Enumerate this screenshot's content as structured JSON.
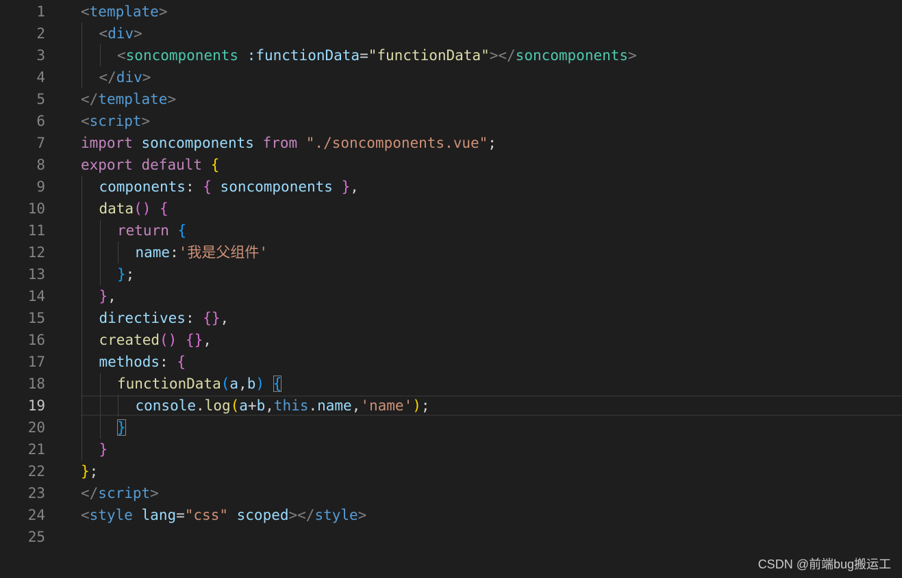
{
  "editor": {
    "active_line": 19,
    "lines": [
      {
        "n": "1",
        "indent": 0,
        "tokens": [
          {
            "t": "<",
            "c": "#808080"
          },
          {
            "t": "template",
            "c": "#569cd6"
          },
          {
            "t": ">",
            "c": "#808080"
          }
        ]
      },
      {
        "n": "2",
        "indent": 1,
        "tokens": [
          {
            "t": "<",
            "c": "#808080"
          },
          {
            "t": "div",
            "c": "#569cd6"
          },
          {
            "t": ">",
            "c": "#808080"
          }
        ]
      },
      {
        "n": "3",
        "indent": 2,
        "tokens": [
          {
            "t": "<",
            "c": "#808080"
          },
          {
            "t": "soncomponents",
            "c": "#4ec9b0"
          },
          {
            "t": " ",
            "c": "#d4d4d4"
          },
          {
            "t": ":functionData",
            "c": "#9cdcfe"
          },
          {
            "t": "=",
            "c": "#d4d4d4"
          },
          {
            "t": "\"functionData\"",
            "c": "#dcdcaa"
          },
          {
            "t": "></",
            "c": "#808080"
          },
          {
            "t": "soncomponents",
            "c": "#4ec9b0"
          },
          {
            "t": ">",
            "c": "#808080"
          }
        ]
      },
      {
        "n": "4",
        "indent": 1,
        "tokens": [
          {
            "t": "</",
            "c": "#808080"
          },
          {
            "t": "div",
            "c": "#569cd6"
          },
          {
            "t": ">",
            "c": "#808080"
          }
        ]
      },
      {
        "n": "5",
        "indent": 0,
        "tokens": [
          {
            "t": "</",
            "c": "#808080"
          },
          {
            "t": "template",
            "c": "#569cd6"
          },
          {
            "t": ">",
            "c": "#808080"
          }
        ]
      },
      {
        "n": "6",
        "indent": 0,
        "tokens": [
          {
            "t": "<",
            "c": "#808080"
          },
          {
            "t": "script",
            "c": "#569cd6"
          },
          {
            "t": ">",
            "c": "#808080"
          }
        ]
      },
      {
        "n": "7",
        "indent": 0,
        "tokens": [
          {
            "t": "import",
            "c": "#c586c0"
          },
          {
            "t": " ",
            "c": "#d4d4d4"
          },
          {
            "t": "soncomponents",
            "c": "#9cdcfe"
          },
          {
            "t": " ",
            "c": "#d4d4d4"
          },
          {
            "t": "from",
            "c": "#c586c0"
          },
          {
            "t": " ",
            "c": "#d4d4d4"
          },
          {
            "t": "\"./soncomponents.vue\"",
            "c": "#ce9178"
          },
          {
            "t": ";",
            "c": "#d4d4d4"
          }
        ]
      },
      {
        "n": "8",
        "indent": 0,
        "tokens": [
          {
            "t": "export",
            "c": "#c586c0"
          },
          {
            "t": " ",
            "c": "#d4d4d4"
          },
          {
            "t": "default",
            "c": "#c586c0"
          },
          {
            "t": " ",
            "c": "#d4d4d4"
          },
          {
            "t": "{",
            "c": "#ffd700"
          }
        ]
      },
      {
        "n": "9",
        "indent": 1,
        "tokens": [
          {
            "t": "components",
            "c": "#9cdcfe"
          },
          {
            "t": ": ",
            "c": "#d4d4d4"
          },
          {
            "t": "{",
            "c": "#da70d6"
          },
          {
            "t": " ",
            "c": "#d4d4d4"
          },
          {
            "t": "soncomponents",
            "c": "#9cdcfe"
          },
          {
            "t": " ",
            "c": "#d4d4d4"
          },
          {
            "t": "}",
            "c": "#da70d6"
          },
          {
            "t": ",",
            "c": "#d4d4d4"
          }
        ]
      },
      {
        "n": "10",
        "indent": 1,
        "tokens": [
          {
            "t": "data",
            "c": "#dcdcaa"
          },
          {
            "t": "()",
            "c": "#da70d6"
          },
          {
            "t": " ",
            "c": "#d4d4d4"
          },
          {
            "t": "{",
            "c": "#da70d6"
          }
        ]
      },
      {
        "n": "11",
        "indent": 2,
        "tokens": [
          {
            "t": "return",
            "c": "#c586c0"
          },
          {
            "t": " ",
            "c": "#d4d4d4"
          },
          {
            "t": "{",
            "c": "#179fff"
          }
        ]
      },
      {
        "n": "12",
        "indent": 3,
        "tokens": [
          {
            "t": "name",
            "c": "#9cdcfe"
          },
          {
            "t": ":",
            "c": "#d4d4d4"
          },
          {
            "t": "'我是父组件'",
            "c": "#ce9178"
          }
        ]
      },
      {
        "n": "13",
        "indent": 2,
        "tokens": [
          {
            "t": "}",
            "c": "#179fff"
          },
          {
            "t": ";",
            "c": "#d4d4d4"
          }
        ]
      },
      {
        "n": "14",
        "indent": 1,
        "tokens": [
          {
            "t": "}",
            "c": "#da70d6"
          },
          {
            "t": ",",
            "c": "#d4d4d4"
          }
        ]
      },
      {
        "n": "15",
        "indent": 1,
        "tokens": [
          {
            "t": "directives",
            "c": "#9cdcfe"
          },
          {
            "t": ": ",
            "c": "#d4d4d4"
          },
          {
            "t": "{}",
            "c": "#da70d6"
          },
          {
            "t": ",",
            "c": "#d4d4d4"
          }
        ]
      },
      {
        "n": "16",
        "indent": 1,
        "tokens": [
          {
            "t": "created",
            "c": "#dcdcaa"
          },
          {
            "t": "()",
            "c": "#da70d6"
          },
          {
            "t": " ",
            "c": "#d4d4d4"
          },
          {
            "t": "{}",
            "c": "#da70d6"
          },
          {
            "t": ",",
            "c": "#d4d4d4"
          }
        ]
      },
      {
        "n": "17",
        "indent": 1,
        "tokens": [
          {
            "t": "methods",
            "c": "#9cdcfe"
          },
          {
            "t": ": ",
            "c": "#d4d4d4"
          },
          {
            "t": "{",
            "c": "#da70d6"
          }
        ]
      },
      {
        "n": "18",
        "indent": 2,
        "tokens": [
          {
            "t": "functionData",
            "c": "#dcdcaa"
          },
          {
            "t": "(",
            "c": "#179fff"
          },
          {
            "t": "a",
            "c": "#9cdcfe"
          },
          {
            "t": ",",
            "c": "#d4d4d4"
          },
          {
            "t": "b",
            "c": "#9cdcfe"
          },
          {
            "t": ")",
            "c": "#179fff"
          },
          {
            "t": " ",
            "c": "#d4d4d4"
          },
          {
            "t": "{",
            "c": "#179fff",
            "box": true
          }
        ]
      },
      {
        "n": "19",
        "indent": 3,
        "tokens": [
          {
            "t": "console",
            "c": "#9cdcfe"
          },
          {
            "t": ".",
            "c": "#d4d4d4"
          },
          {
            "t": "log",
            "c": "#dcdcaa"
          },
          {
            "t": "(",
            "c": "#ffd700"
          },
          {
            "t": "a",
            "c": "#9cdcfe"
          },
          {
            "t": "+",
            "c": "#d4d4d4"
          },
          {
            "t": "b",
            "c": "#9cdcfe"
          },
          {
            "t": ",",
            "c": "#d4d4d4"
          },
          {
            "t": "this",
            "c": "#569cd6"
          },
          {
            "t": ".",
            "c": "#d4d4d4"
          },
          {
            "t": "name",
            "c": "#9cdcfe"
          },
          {
            "t": ",",
            "c": "#d4d4d4"
          },
          {
            "t": "'name'",
            "c": "#ce9178"
          },
          {
            "t": ")",
            "c": "#ffd700"
          },
          {
            "t": ";",
            "c": "#d4d4d4"
          }
        ]
      },
      {
        "n": "20",
        "indent": 2,
        "tokens": [
          {
            "t": "}",
            "c": "#179fff",
            "box": true
          }
        ]
      },
      {
        "n": "21",
        "indent": 1,
        "tokens": [
          {
            "t": "}",
            "c": "#da70d6"
          }
        ]
      },
      {
        "n": "22",
        "indent": 0,
        "tokens": [
          {
            "t": "}",
            "c": "#ffd700"
          },
          {
            "t": ";",
            "c": "#d4d4d4"
          }
        ]
      },
      {
        "n": "23",
        "indent": 0,
        "tokens": [
          {
            "t": "</",
            "c": "#808080"
          },
          {
            "t": "script",
            "c": "#569cd6"
          },
          {
            "t": ">",
            "c": "#808080"
          }
        ]
      },
      {
        "n": "24",
        "indent": 0,
        "tokens": [
          {
            "t": "<",
            "c": "#808080"
          },
          {
            "t": "style",
            "c": "#569cd6"
          },
          {
            "t": " ",
            "c": "#d4d4d4"
          },
          {
            "t": "lang",
            "c": "#9cdcfe"
          },
          {
            "t": "=",
            "c": "#d4d4d4"
          },
          {
            "t": "\"css\"",
            "c": "#ce9178"
          },
          {
            "t": " ",
            "c": "#d4d4d4"
          },
          {
            "t": "scoped",
            "c": "#9cdcfe"
          },
          {
            "t": "></",
            "c": "#808080"
          },
          {
            "t": "style",
            "c": "#569cd6"
          },
          {
            "t": ">",
            "c": "#808080"
          }
        ]
      },
      {
        "n": "25",
        "indent": 0,
        "tokens": []
      }
    ]
  },
  "watermark": "CSDN @前端bug搬运工"
}
